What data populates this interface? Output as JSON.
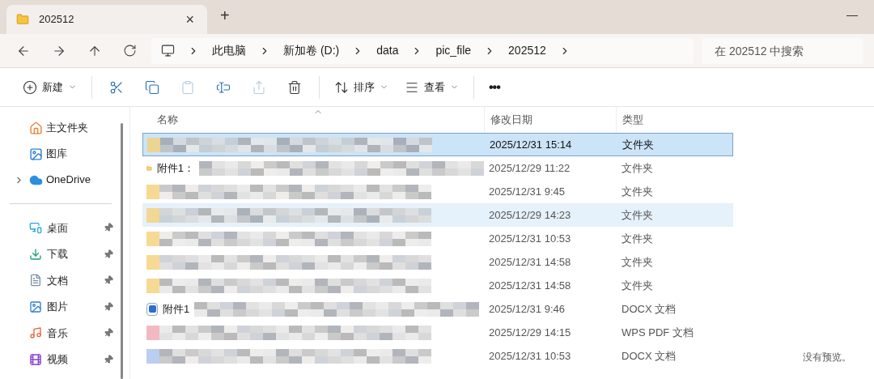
{
  "tab": {
    "title": "202512",
    "close": "×",
    "new_tab": "+"
  },
  "window": {
    "minimize": "—"
  },
  "breadcrumb": [
    "此电脑",
    "新加卷 (D:)",
    "data",
    "pic_file",
    "202512"
  ],
  "search": {
    "placeholder": "在 202512 中搜索"
  },
  "toolbar": [
    {
      "kind": "new",
      "label": "新建",
      "disabled": false
    },
    {
      "kind": "cut",
      "disabled": false
    },
    {
      "kind": "copy",
      "disabled": false
    },
    {
      "kind": "paste",
      "disabled": true
    },
    {
      "kind": "rename",
      "disabled": false
    },
    {
      "kind": "share",
      "disabled": true
    },
    {
      "kind": "delete",
      "disabled": false
    },
    {
      "kind": "sort",
      "label": "排序",
      "disabled": false
    },
    {
      "kind": "view",
      "label": "查看",
      "disabled": false
    },
    {
      "kind": "more",
      "label": "•••",
      "disabled": false
    }
  ],
  "sidebar": {
    "top": [
      {
        "label": "主文件夹",
        "expandable": false
      },
      {
        "label": "图库",
        "expandable": false
      },
      {
        "label": "OneDrive",
        "expandable": true
      }
    ],
    "pinned": [
      {
        "label": "桌面",
        "pinned": true
      },
      {
        "label": "下载",
        "pinned": true
      },
      {
        "label": "文档",
        "pinned": true
      },
      {
        "label": "图片",
        "pinned": true
      },
      {
        "label": "音乐",
        "pinned": true
      },
      {
        "label": "视频",
        "pinned": true
      }
    ]
  },
  "table": {
    "columns": [
      "名称",
      "修改日期",
      "类型"
    ],
    "rows": [
      {
        "kind": "folder",
        "date": "2025/12/31 15:14",
        "type": "文件夹",
        "selected": true,
        "hovered": false
      },
      {
        "kind": "folder",
        "name": "附件1：",
        "date": "2025/12/29 11:22",
        "type": "文件夹",
        "selected": false,
        "hovered": false
      },
      {
        "kind": "folder",
        "date": "2025/12/31 9:45",
        "type": "文件夹",
        "selected": false,
        "hovered": false
      },
      {
        "kind": "folder",
        "date": "2025/12/29 14:23",
        "type": "文件夹",
        "selected": false,
        "hovered": true
      },
      {
        "kind": "folder",
        "date": "2025/12/31 10:53",
        "type": "文件夹",
        "selected": false,
        "hovered": false
      },
      {
        "kind": "folder",
        "date": "2025/12/31 14:58",
        "type": "文件夹",
        "selected": false,
        "hovered": false
      },
      {
        "kind": "folder",
        "date": "2025/12/31 14:58",
        "type": "文件夹",
        "selected": false,
        "hovered": false
      },
      {
        "kind": "docx",
        "name": "附件1",
        "date": "2025/12/31 9:46",
        "type": "DOCX 文档",
        "selected": false,
        "hovered": false
      },
      {
        "kind": "pdf",
        "date": "2025/12/29 14:15",
        "type": "WPS PDF 文档",
        "selected": false,
        "hovered": false
      },
      {
        "kind": "docx",
        "date": "2025/12/31 10:53",
        "type": "DOCX 文档",
        "selected": false,
        "hovered": false
      }
    ]
  },
  "preview": {
    "text": "没有预览。"
  }
}
